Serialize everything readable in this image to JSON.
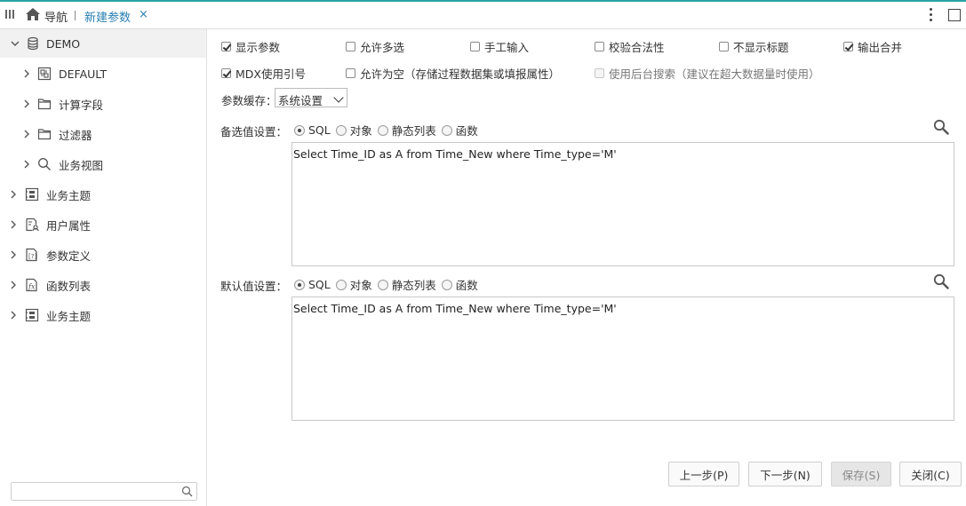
{
  "topbar": {
    "nav_label": "导航",
    "tab_label": "新建参数",
    "tab_close": "×"
  },
  "sidebar": {
    "root": {
      "label": "DEMO",
      "icon": "database-icon"
    },
    "children": [
      {
        "label": "DEFAULT",
        "icon": "schema-icon"
      },
      {
        "label": "计算字段",
        "icon": "folder-icon"
      },
      {
        "label": "过滤器",
        "icon": "folder-icon"
      },
      {
        "label": "业务视图",
        "icon": "search-icon"
      }
    ],
    "items": [
      {
        "label": "业务主题",
        "icon": "business-theme-icon"
      },
      {
        "label": "用户属性",
        "icon": "user-attribute-icon"
      },
      {
        "label": "参数定义",
        "icon": "parameter-icon"
      },
      {
        "label": "函数列表",
        "icon": "function-icon"
      },
      {
        "label": "业务主题",
        "icon": "business-theme-icon"
      }
    ],
    "search_placeholder": ""
  },
  "options": {
    "show_param": "显示参数",
    "allow_multi": "允许多选",
    "manual_input": "手工输入",
    "validate": "校验合法性",
    "hide_title": "不显示标题",
    "merge_output": "输出合并",
    "mdx_quote": "MDX使用引号",
    "allow_empty": "允许为空（存储过程数据集或填报属性）",
    "backend_search": "使用后台搜索（建议在超大数据量时使用）"
  },
  "cache": {
    "label": "参数缓存：",
    "value": "系统设置"
  },
  "candidate": {
    "label": "备选值设置：",
    "sql_text": "Select Time_ID as A from Time_New where Time_type='M'"
  },
  "default": {
    "label": "默认值设置：",
    "sql_text": "Select Time_ID as A from Time_New where Time_type='M'"
  },
  "radio_options": {
    "sql": "SQL",
    "object": "对象",
    "static_list": "静态列表",
    "function": "函数"
  },
  "buttons": {
    "prev": "上一步(P)",
    "next": "下一步(N)",
    "save": "保存(S)",
    "close": "关闭(C)"
  }
}
